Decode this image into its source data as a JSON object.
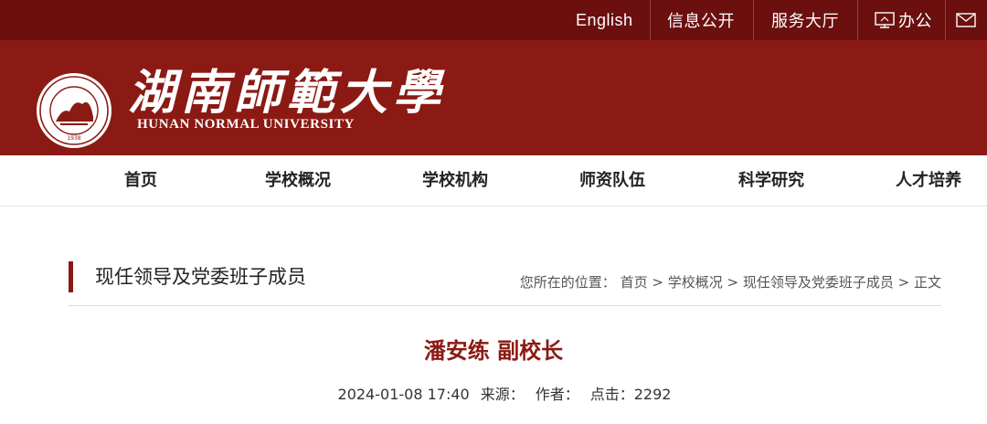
{
  "topbar": {
    "english": "English",
    "info_public": "信息公开",
    "service_hall": "服务大厅",
    "office": "办公",
    "office_icon": "monitor-icon",
    "mail_icon": "mail-icon",
    "background": "#6b0f0f"
  },
  "header": {
    "logo_cn": "湖南師範大學",
    "logo_en": "HUNAN NORMAL UNIVERSITY",
    "seal_year": "1938",
    "background": "#8b1a14"
  },
  "nav": {
    "items": [
      {
        "label": "首页"
      },
      {
        "label": "学校概况"
      },
      {
        "label": "学校机构"
      },
      {
        "label": "师资队伍"
      },
      {
        "label": "科学研究"
      },
      {
        "label": "人才培养"
      }
    ]
  },
  "section": {
    "title": "现任领导及党委班子成员",
    "breadcrumb_prefix": "您所在的位置：",
    "breadcrumb": [
      "首页",
      "学校概况",
      "现任领导及党委班子成员",
      "正文"
    ],
    "separator": " > "
  },
  "article": {
    "title": "潘安练 副校长",
    "date": "2024-01-08 17:40",
    "source_label": "来源：",
    "author_label": "作者：",
    "clicks_label": "点击：",
    "clicks": "2292",
    "accent_color": "#8b1a14"
  }
}
